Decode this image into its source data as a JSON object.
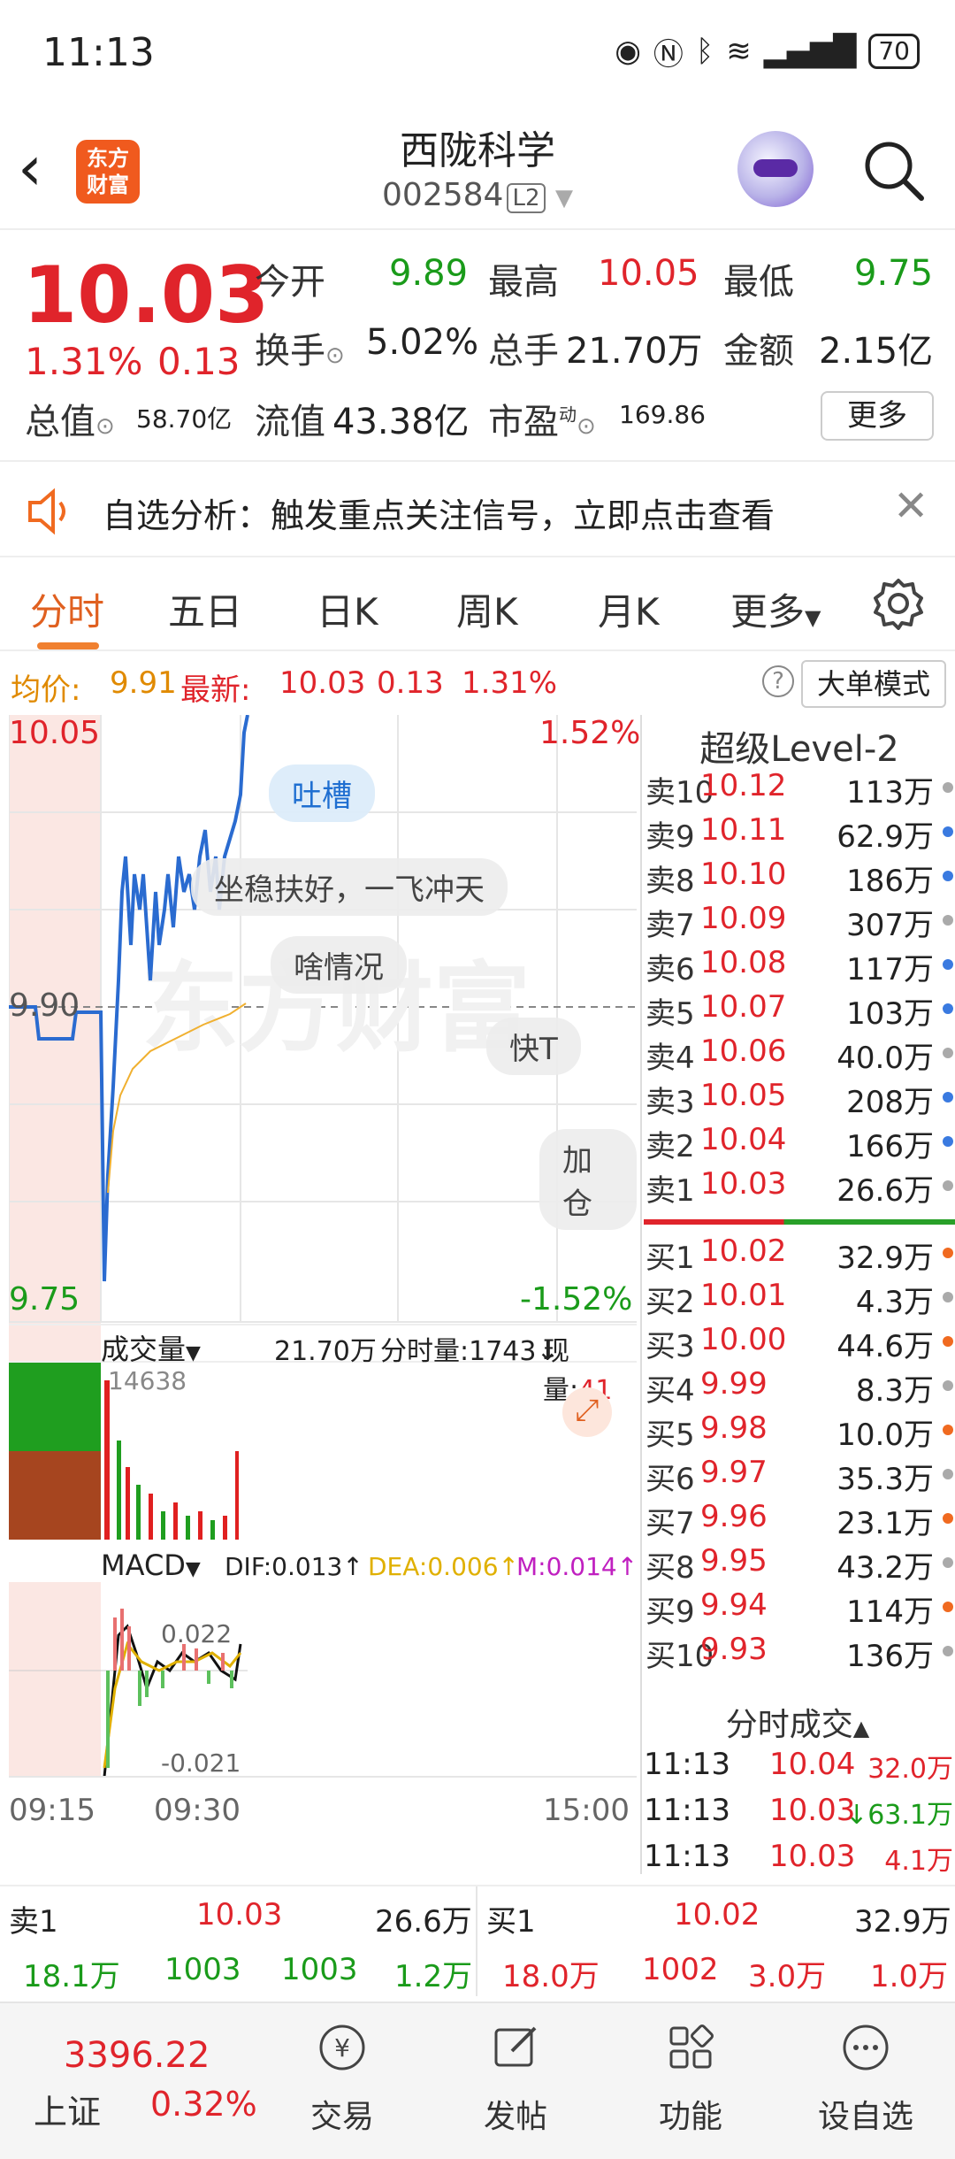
{
  "status_bar": {
    "time": "11:13",
    "battery": "70"
  },
  "header": {
    "logo_text": "东方\n财富",
    "title": "西陇科学",
    "code": "002584",
    "level_badge": "L2"
  },
  "quote": {
    "price": "10.03",
    "change_pct": "1.31%",
    "change_val": "0.13",
    "open_label": "今开",
    "open": "9.89",
    "high_label": "最高",
    "high": "10.05",
    "low_label": "最低",
    "low": "9.75",
    "turnover_label": "换手",
    "turnover": "5.02%",
    "volume_label": "总手",
    "volume": "21.70万",
    "amount_label": "金额",
    "amount": "2.15亿",
    "mktcap_label": "总值",
    "mktcap": "58.70亿",
    "float_label": "流值",
    "float": "43.38亿",
    "pe_label": "市盈",
    "pe_sup": "动",
    "pe": "169.86",
    "more_label": "更多"
  },
  "notice": {
    "text": "自选分析：触发重点关注信号，立即点击查看"
  },
  "tabs": [
    "分时",
    "五日",
    "日K",
    "周K",
    "月K",
    "更多"
  ],
  "info": {
    "avg_label": "均价:",
    "avg": "9.91",
    "latest_label": "最新:",
    "latest": "10.03",
    "chg": "0.13",
    "pct": "1.31%",
    "big_order": "大单模式"
  },
  "chart": {
    "price_high": "10.05",
    "price_low": "9.75",
    "pct_high": "1.52%",
    "pct_low": "-1.52%",
    "mid_price": "9.90",
    "bubbles": [
      "吐槽",
      "坐稳扶好，一飞冲天",
      "啥情况",
      "快T",
      "加仓"
    ],
    "vol_label": "成交量",
    "vol_total": "21.70万",
    "vol_split": "分时量:1743↓",
    "vol_now_label": "现量:",
    "vol_now": "41",
    "vol_max": "14638",
    "macd_label": "MACD",
    "dif": "DIF:0.013↑",
    "dea": "DEA:0.006↑",
    "m": "M:0.014↑",
    "macd_high": "0.022",
    "macd_low": "-0.021",
    "time_start": "09:15",
    "time_open": "09:30",
    "time_end": "15:00"
  },
  "order_book": {
    "title": "超级Level-2",
    "asks": [
      {
        "label": "卖10",
        "price": "10.12",
        "vol": "113万"
      },
      {
        "label": "卖9",
        "price": "10.11",
        "vol": "62.9万"
      },
      {
        "label": "卖8",
        "price": "10.10",
        "vol": "186万"
      },
      {
        "label": "卖7",
        "price": "10.09",
        "vol": "307万"
      },
      {
        "label": "卖6",
        "price": "10.08",
        "vol": "117万"
      },
      {
        "label": "卖5",
        "price": "10.07",
        "vol": "103万"
      },
      {
        "label": "卖4",
        "price": "10.06",
        "vol": "40.0万"
      },
      {
        "label": "卖3",
        "price": "10.05",
        "vol": "208万"
      },
      {
        "label": "卖2",
        "price": "10.04",
        "vol": "166万"
      },
      {
        "label": "卖1",
        "price": "10.03",
        "vol": "26.6万"
      }
    ],
    "bids": [
      {
        "label": "买1",
        "price": "10.02",
        "vol": "32.9万"
      },
      {
        "label": "买2",
        "price": "10.01",
        "vol": "4.3万"
      },
      {
        "label": "买3",
        "price": "10.00",
        "vol": "44.6万"
      },
      {
        "label": "买4",
        "price": "9.99",
        "vol": "8.3万"
      },
      {
        "label": "买5",
        "price": "9.98",
        "vol": "10.0万"
      },
      {
        "label": "买6",
        "price": "9.97",
        "vol": "35.3万"
      },
      {
        "label": "买7",
        "price": "9.96",
        "vol": "23.1万"
      },
      {
        "label": "买8",
        "price": "9.95",
        "vol": "43.2万"
      },
      {
        "label": "买9",
        "price": "9.94",
        "vol": "114万"
      },
      {
        "label": "买10",
        "price": "9.93",
        "vol": "136万"
      }
    ],
    "trades_title": "分时成交",
    "trades": [
      {
        "time": "11:13",
        "price": "10.04",
        "vol": "32.0万"
      },
      {
        "time": "11:13",
        "price": "10.03",
        "vol": "↓63.1万"
      },
      {
        "time": "11:13",
        "price": "10.03",
        "vol": "4.1万"
      }
    ]
  },
  "summary": {
    "sell1_label": "卖1",
    "sell1_price": "10.03",
    "sell1_vol": "26.6万",
    "buy1_label": "买1",
    "buy1_price": "10.02",
    "buy1_vol": "32.9万",
    "left_row": [
      "18.1万",
      "1003",
      "1003",
      "1.2万"
    ],
    "right_row": [
      "18.0万",
      "1002",
      "3.0万",
      "1.0万"
    ]
  },
  "nav": {
    "index_value": "3396.22",
    "index_name": "上证",
    "index_pct": "0.32%",
    "items": [
      "交易",
      "发帖",
      "功能",
      "设自选"
    ]
  }
}
